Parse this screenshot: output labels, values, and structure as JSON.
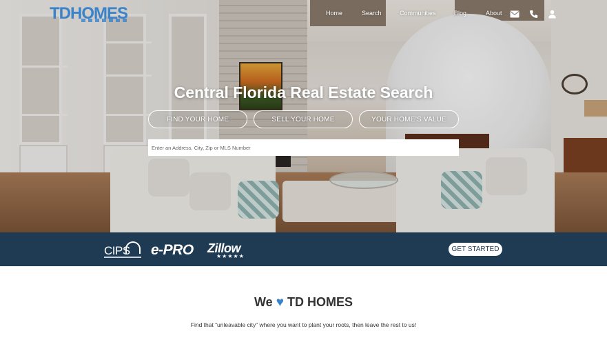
{
  "header": {
    "logo": "TDHOMES",
    "nav": {
      "home": "Home",
      "search": "Search",
      "communities": "Communities",
      "blog": "Blog",
      "about": "About"
    }
  },
  "hero": {
    "title": "Central Florida Real Estate Search",
    "buttons": {
      "find": "FIND YOUR HOME",
      "sell": "SELL YOUR HOME",
      "value": "YOUR HOME’S VALUE"
    },
    "search_placeholder": "Enter an Address, City, Zip or MLS Number"
  },
  "cert_bar": {
    "cips": "CIPS",
    "epro": "e-PRO",
    "zillow": "Zillow",
    "zillow_stars": "★★★★★",
    "cta": "GET STARTED"
  },
  "about": {
    "we": "We",
    "heart": "♥",
    "brand": "TD HOMES",
    "tagline": "Find that “unleavable city” where you want to plant your roots, then leave the rest to us!"
  },
  "colors": {
    "brand_blue": "#3a83c9",
    "bar_navy": "#1f3a53"
  },
  "icons": [
    "email-icon",
    "phone-icon",
    "user-icon"
  ]
}
